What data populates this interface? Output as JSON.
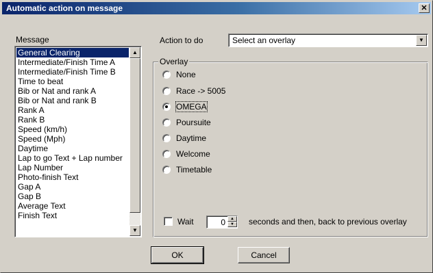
{
  "window": {
    "title": "Automatic action on message",
    "close_icon": "✕"
  },
  "message": {
    "label": "Message",
    "items": [
      "General Clearing",
      "Intermediate/Finish Time A",
      "Intermediate/Finish Time B",
      "Time to beat",
      "Bib or Nat and rank A",
      "Bib or Nat and rank B",
      "Rank A",
      "Rank B",
      "Speed (km/h)",
      "Speed (Mph)",
      "Daytime",
      "Lap to go Text + Lap number",
      "Lap Number",
      "Photo-finish Text",
      "Gap A",
      "Gap B",
      "Average Text",
      "Finish Text"
    ],
    "selected_index": 0
  },
  "action": {
    "label": "Action to do",
    "selected": "Select an overlay"
  },
  "overlay": {
    "title": "Overlay",
    "options": [
      "None",
      "Race -> 5005",
      "OMEGA",
      "Poursuite",
      "Daytime",
      "Welcome",
      "Timetable"
    ],
    "selected": "OMEGA"
  },
  "wait": {
    "label": "Wait",
    "checked": false,
    "value": "0",
    "suffix": "seconds and then, back to previous overlay"
  },
  "buttons": {
    "ok": "OK",
    "cancel": "Cancel"
  }
}
